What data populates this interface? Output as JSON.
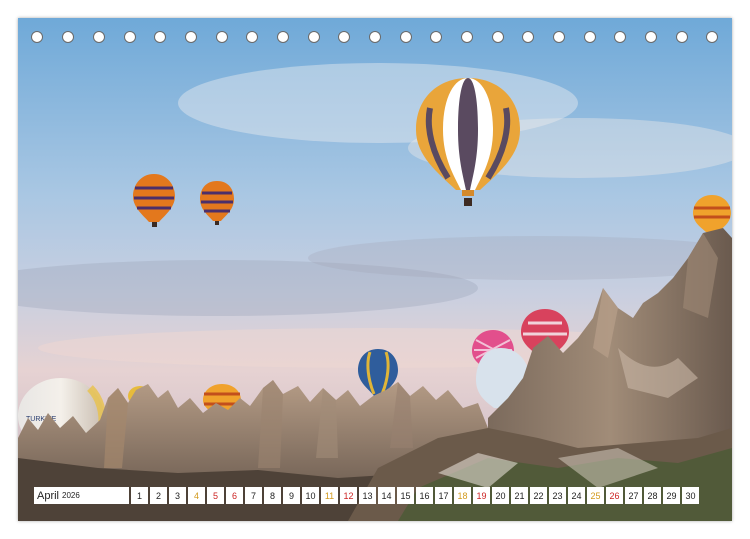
{
  "calendar": {
    "month": "April",
    "year": "2026",
    "days": [
      {
        "label": "1",
        "type": "weekday"
      },
      {
        "label": "2",
        "type": "weekday"
      },
      {
        "label": "3",
        "type": "weekday"
      },
      {
        "label": "4",
        "type": "sat"
      },
      {
        "label": "5",
        "type": "sun"
      },
      {
        "label": "6",
        "type": "sun"
      },
      {
        "label": "7",
        "type": "weekday"
      },
      {
        "label": "8",
        "type": "weekday"
      },
      {
        "label": "9",
        "type": "weekday"
      },
      {
        "label": "10",
        "type": "weekday"
      },
      {
        "label": "11",
        "type": "sat"
      },
      {
        "label": "12",
        "type": "sun"
      },
      {
        "label": "13",
        "type": "weekday"
      },
      {
        "label": "14",
        "type": "weekday"
      },
      {
        "label": "15",
        "type": "weekday"
      },
      {
        "label": "16",
        "type": "weekday"
      },
      {
        "label": "17",
        "type": "weekday"
      },
      {
        "label": "18",
        "type": "sat"
      },
      {
        "label": "19",
        "type": "sun"
      },
      {
        "label": "20",
        "type": "weekday"
      },
      {
        "label": "21",
        "type": "weekday"
      },
      {
        "label": "22",
        "type": "weekday"
      },
      {
        "label": "23",
        "type": "weekday"
      },
      {
        "label": "24",
        "type": "weekday"
      },
      {
        "label": "25",
        "type": "sat"
      },
      {
        "label": "26",
        "type": "sun"
      },
      {
        "label": "27",
        "type": "weekday"
      },
      {
        "label": "28",
        "type": "weekday"
      },
      {
        "label": "29",
        "type": "weekday"
      },
      {
        "label": "30",
        "type": "weekday"
      }
    ]
  },
  "photo": {
    "balloon_text": "TURKIYE",
    "colors": {
      "sky_top": "#7fb0da",
      "sky_mid": "#bcd0e6",
      "sky_low": "#e9d3d3",
      "rock": "#8b7a6a",
      "accent": "#e07b22"
    }
  }
}
